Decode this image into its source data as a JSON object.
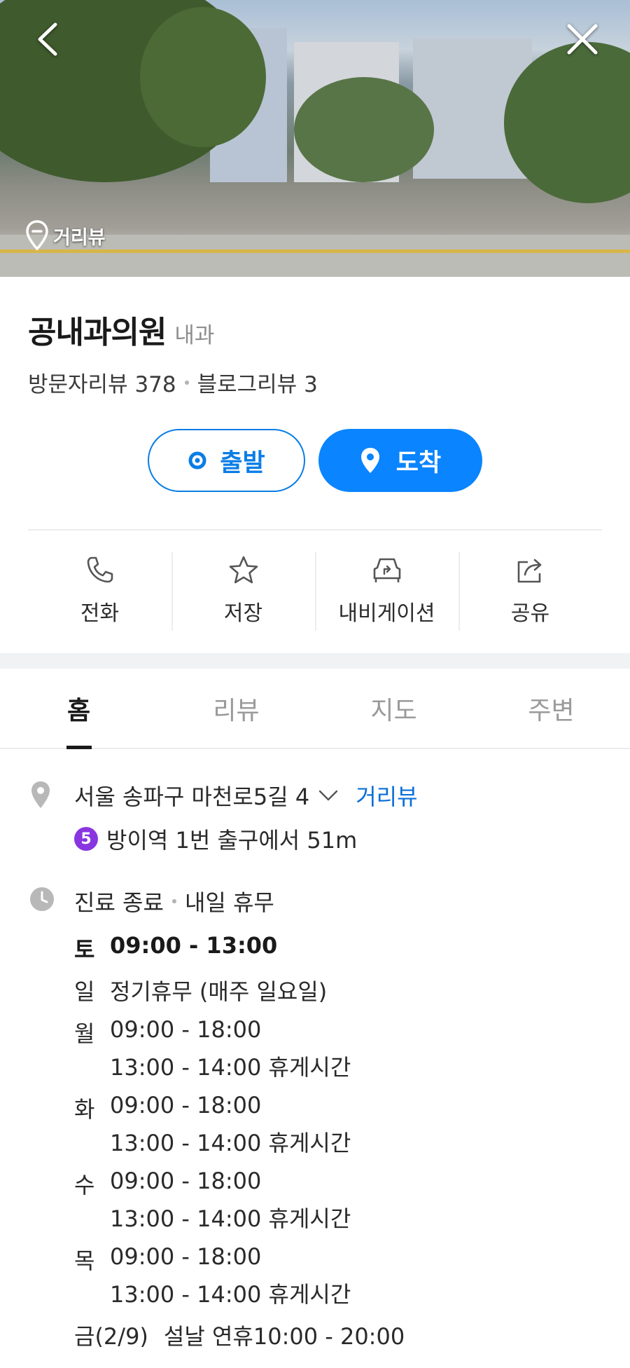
{
  "hero": {
    "street_view_label": "거리뷰",
    "back_icon": "chevron-left-icon",
    "close_icon": "close-icon"
  },
  "place": {
    "name": "공내과의원",
    "category": "내과",
    "visitor_reviews": "방문자리뷰 378",
    "blog_reviews": "블로그리뷰 3"
  },
  "route": {
    "depart_label": "출발",
    "arrive_label": "도착"
  },
  "actions": [
    {
      "label": "전화",
      "icon": "phone-icon"
    },
    {
      "label": "저장",
      "icon": "star-icon"
    },
    {
      "label": "내비게이션",
      "icon": "car-navigation-icon"
    },
    {
      "label": "공유",
      "icon": "share-icon"
    }
  ],
  "tabs": [
    "홈",
    "리뷰",
    "지도",
    "주변"
  ],
  "info": {
    "address": "서울 송파구 마천로5길 4",
    "street_view_link": "거리뷰",
    "subway_line": "5",
    "subway_direction": "방이역 1번 출구에서 51m",
    "status": "진료 종료",
    "status_next": "내일 휴무"
  },
  "hours": [
    {
      "day": "토",
      "lines": [
        "09:00 - 13:00"
      ],
      "today": true
    },
    {
      "day": "일",
      "lines": [
        "정기휴무 (매주 일요일)"
      ]
    },
    {
      "day": "월",
      "lines": [
        "09:00 - 18:00",
        "13:00 - 14:00 휴게시간"
      ]
    },
    {
      "day": "화",
      "lines": [
        "09:00 - 18:00",
        "13:00 - 14:00 휴게시간"
      ]
    },
    {
      "day": "수",
      "lines": [
        "09:00 - 18:00",
        "13:00 - 14:00 휴게시간"
      ]
    },
    {
      "day": "목",
      "lines": [
        "09:00 - 18:00",
        "13:00 - 14:00 휴게시간"
      ]
    },
    {
      "day": "금(2/9)",
      "lines": [
        "설날 연휴10:00 - 20:00"
      ]
    }
  ],
  "colors": {
    "accent": "#0a84ff",
    "link": "#0a6fd6",
    "subway_line_5": "#8936e0"
  }
}
